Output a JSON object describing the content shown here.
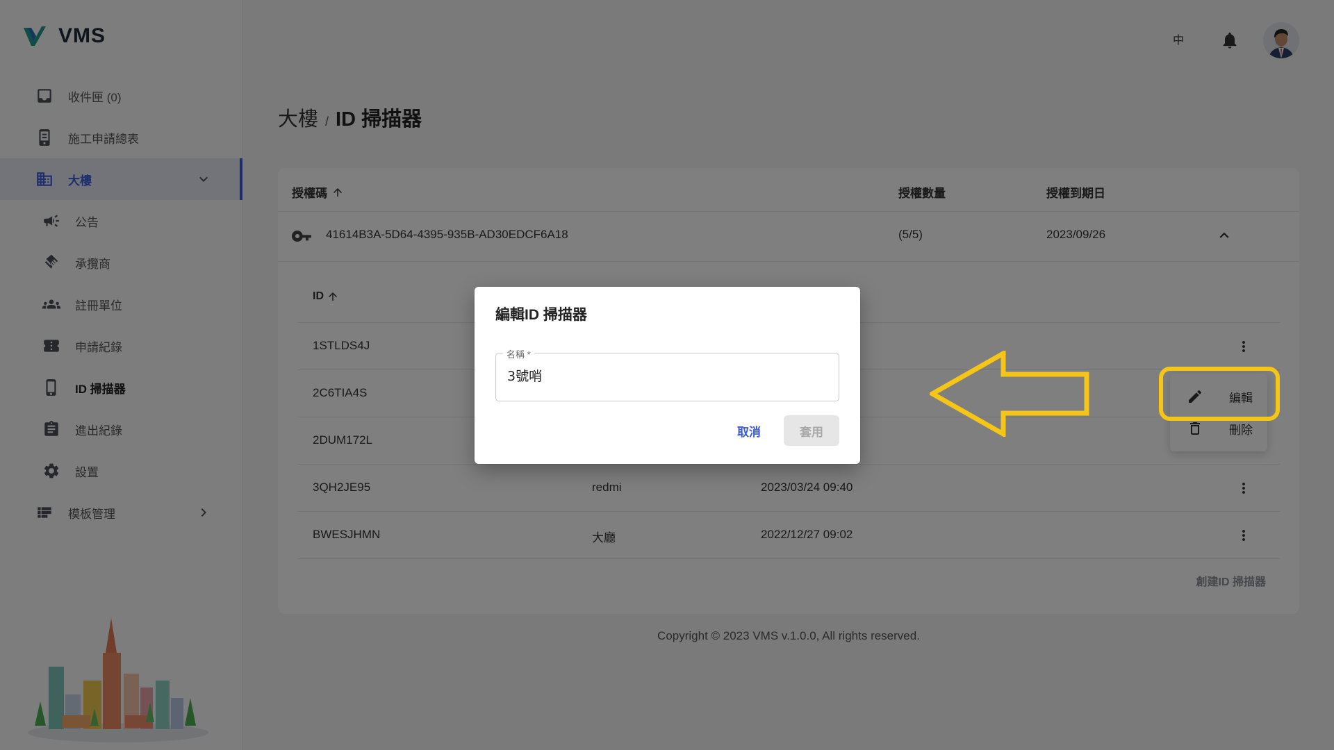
{
  "app": {
    "name": "VMS"
  },
  "header": {
    "language": "中"
  },
  "sidebar": {
    "items": [
      {
        "label": "收件匣 (0)",
        "icon": "inbox-icon"
      },
      {
        "label": "施工申請總表",
        "icon": "tablet-icon"
      },
      {
        "label": "大樓",
        "icon": "building-icon",
        "expanded": true
      },
      {
        "label": "公告",
        "icon": "megaphone-icon"
      },
      {
        "label": "承攬商",
        "icon": "handshake-icon"
      },
      {
        "label": "註冊單位",
        "icon": "people-icon"
      },
      {
        "label": "申請紀錄",
        "icon": "ticket-icon"
      },
      {
        "label": "ID 掃描器",
        "icon": "phone-icon"
      },
      {
        "label": "進出紀錄",
        "icon": "clipboard-icon"
      },
      {
        "label": "設置",
        "icon": "gear-icon"
      },
      {
        "label": "模板管理",
        "icon": "template-icon"
      }
    ]
  },
  "breadcrumb": {
    "parent": "大樓",
    "separator": "/",
    "current": "ID 掃描器"
  },
  "license_table": {
    "headers": {
      "code": "授權碼",
      "quantity": "授權數量",
      "expiry": "授權到期日"
    },
    "row": {
      "code": "41614B3A-5D64-4395-935B-AD30EDCF6A18",
      "quantity": "(5/5)",
      "expiry": "2023/09/26"
    }
  },
  "scanner_table": {
    "header_id": "ID",
    "rows": [
      {
        "id": "1STLDS4J",
        "name": "",
        "time": ""
      },
      {
        "id": "2C6TIA4S",
        "name": "",
        "time": ""
      },
      {
        "id": "2DUM172L",
        "name": "",
        "time": ""
      },
      {
        "id": "3QH2JE95",
        "name": "redmi",
        "time": "2023/03/24 09:40"
      },
      {
        "id": "BWESJHMN",
        "name": "大廳",
        "time": "2022/12/27 09:02"
      }
    ],
    "create_label": "創建ID 掃描器"
  },
  "context_menu": {
    "edit": "編輯",
    "delete": "刪除"
  },
  "dialog": {
    "title": "編輯ID 掃描器",
    "field_label": "名稱 *",
    "field_value": "3號哨",
    "cancel": "取消",
    "apply": "套用"
  },
  "footer": {
    "text": "Copyright © 2023 VMS v.1.0.0, All rights reserved."
  },
  "colors": {
    "accent": "#3d5bd9",
    "annotation": "#f5c518",
    "overlay": "rgba(0,0,0,0.5)"
  }
}
